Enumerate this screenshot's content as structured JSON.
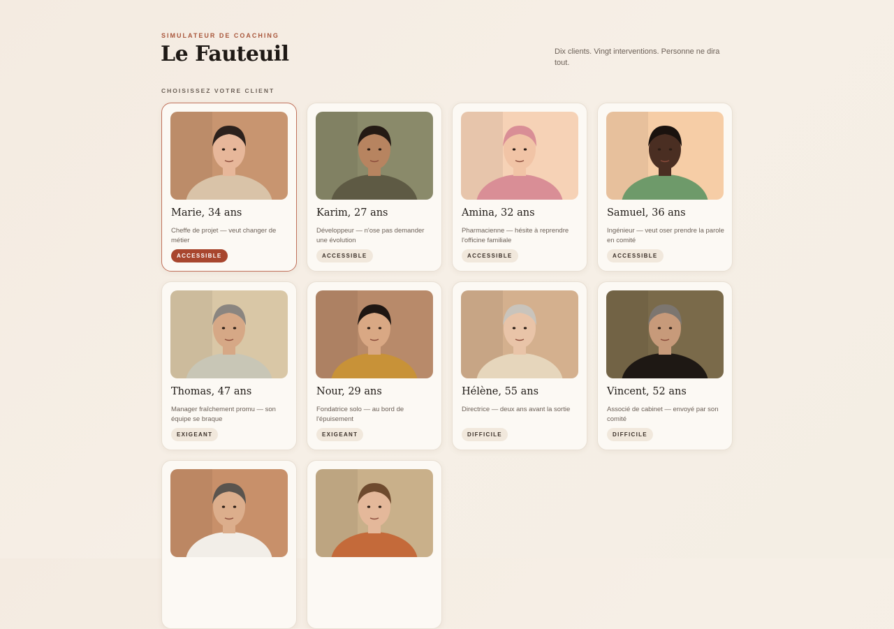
{
  "header": {
    "eyebrow": "SIMULATEUR DE COACHING",
    "title": "Le Fauteuil",
    "tagline": "Dix clients. Vingt interventions. Personne ne dira tout."
  },
  "section_label": "CHOISISSEZ VOTRE CLIENT",
  "colors": {
    "accent": "#a8462e",
    "selected_border": "#c0705a"
  },
  "clients": [
    {
      "name": "Marie, 34 ans",
      "desc": "Cheffe de projet — veut changer de métier",
      "level": "ACCESSIBLE",
      "selected": true,
      "palette": {
        "bg": "#c89570",
        "skin": "#e7b79a",
        "hair": "#2c211c",
        "shirt": "#d9c3a8"
      }
    },
    {
      "name": "Karim, 27 ans",
      "desc": "Développeur — n'ose pas demander une évolution",
      "level": "ACCESSIBLE",
      "selected": false,
      "palette": {
        "bg": "#8a8a6a",
        "skin": "#b78460",
        "hair": "#241a14",
        "shirt": "#5e5a44"
      }
    },
    {
      "name": "Amina, 32 ans",
      "desc": "Pharmacienne — hésite à reprendre l'officine familiale",
      "level": "ACCESSIBLE",
      "selected": false,
      "palette": {
        "bg": "#f6d2b6",
        "skin": "#f1c4a6",
        "hair": "#d98e96",
        "shirt": "#d98e96"
      }
    },
    {
      "name": "Samuel, 36 ans",
      "desc": "Ingénieur — veut oser prendre la parole en comité",
      "level": "ACCESSIBLE",
      "selected": false,
      "palette": {
        "bg": "#f6cda6",
        "skin": "#4a2e22",
        "hair": "#1a120e",
        "shirt": "#6e9a6a"
      }
    },
    {
      "name": "Thomas, 47 ans",
      "desc": "Manager fraîchement promu — son équipe se braque",
      "level": "EXIGEANT",
      "selected": false,
      "palette": {
        "bg": "#d9c7a6",
        "skin": "#d6a886",
        "hair": "#8a8580",
        "shirt": "#c8c6b6"
      }
    },
    {
      "name": "Nour, 29 ans",
      "desc": "Fondatrice solo — au bord de l'épuisement",
      "level": "EXIGEANT",
      "selected": false,
      "palette": {
        "bg": "#b88a6a",
        "skin": "#d9a884",
        "hair": "#1e1612",
        "shirt": "#c89238"
      }
    },
    {
      "name": "Hélène, 55 ans",
      "desc": "Directrice — deux ans avant la sortie",
      "level": "DIFFICILE",
      "selected": false,
      "palette": {
        "bg": "#d4b08e",
        "skin": "#e9c4a8",
        "hair": "#c9c4bc",
        "shirt": "#e6d6bc"
      }
    },
    {
      "name": "Vincent, 52 ans",
      "desc": "Associé de cabinet — envoyé par son comité",
      "level": "DIFFICILE",
      "selected": false,
      "palette": {
        "bg": "#7a6a4a",
        "skin": "#c79a7a",
        "hair": "#7c7670",
        "shirt": "#1e1814"
      }
    },
    {
      "name": "",
      "desc": "",
      "level": "",
      "selected": false,
      "palette": {
        "bg": "#c8906a",
        "skin": "#dcae8c",
        "hair": "#5a544e",
        "shirt": "#f2eee8"
      }
    },
    {
      "name": "",
      "desc": "",
      "level": "",
      "selected": false,
      "palette": {
        "bg": "#c9b08a",
        "skin": "#e4b89a",
        "hair": "#6e4a2e",
        "shirt": "#c46a3a"
      }
    }
  ]
}
